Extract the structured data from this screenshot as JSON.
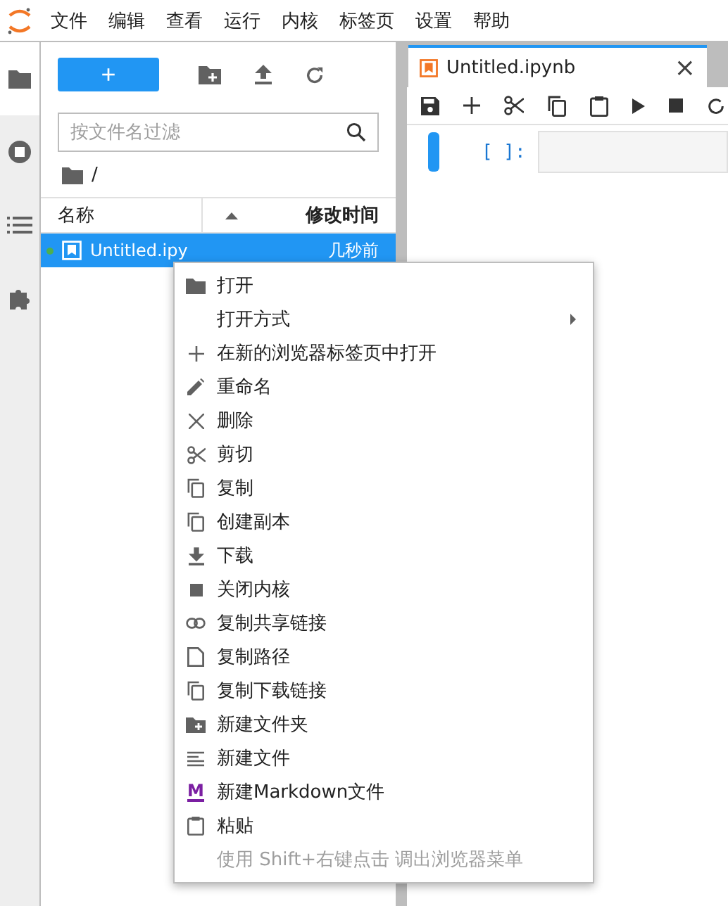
{
  "menubar": {
    "items": [
      "文件",
      "编辑",
      "查看",
      "运行",
      "内核",
      "标签页",
      "设置",
      "帮助"
    ]
  },
  "sidebar_tabs": [
    {
      "selected": true
    },
    {
      "selected": false
    },
    {
      "selected": false
    },
    {
      "selected": false
    }
  ],
  "file_browser": {
    "new_button": "+",
    "filter": {
      "placeholder": "按文件名过滤"
    },
    "breadcrumb": "/",
    "columns": [
      {
        "label": "名称"
      },
      {
        "label": "修改时间"
      }
    ],
    "rows": [
      {
        "name": "Untitled.ipy",
        "modified": "几秒前",
        "selected": true,
        "running": true
      }
    ]
  },
  "notebook": {
    "tab": {
      "title": "Untitled.ipynb",
      "close": "×"
    },
    "cell": {
      "prompt": "[ ]:"
    }
  },
  "context_menu": {
    "items": [
      {
        "label": "打开",
        "submenu": false,
        "disabled": false
      },
      {
        "label": "打开方式",
        "submenu": true,
        "disabled": false
      },
      {
        "label": "在新的浏览器标签页中打开",
        "submenu": false,
        "disabled": false
      },
      {
        "label": "重命名",
        "submenu": false,
        "disabled": false
      },
      {
        "label": "删除",
        "submenu": false,
        "disabled": false
      },
      {
        "label": "剪切",
        "submenu": false,
        "disabled": false
      },
      {
        "label": "复制",
        "submenu": false,
        "disabled": false
      },
      {
        "label": "创建副本",
        "submenu": false,
        "disabled": false
      },
      {
        "label": "下载",
        "submenu": false,
        "disabled": false
      },
      {
        "label": "关闭内核",
        "submenu": false,
        "disabled": false
      },
      {
        "label": "复制共享链接",
        "submenu": false,
        "disabled": false
      },
      {
        "label": "复制路径",
        "submenu": false,
        "disabled": false
      },
      {
        "label": "复制下载链接",
        "submenu": false,
        "disabled": false
      },
      {
        "label": "新建文件夹",
        "submenu": false,
        "disabled": false
      },
      {
        "label": "新建文件",
        "submenu": false,
        "disabled": false
      },
      {
        "label": "新建Markdown文件",
        "submenu": false,
        "disabled": false,
        "icon_text": "M"
      },
      {
        "label": "粘贴",
        "submenu": false,
        "disabled": false
      },
      {
        "label": "使用 Shift+右键点击 调出浏览器菜单",
        "submenu": false,
        "disabled": true
      }
    ]
  }
}
